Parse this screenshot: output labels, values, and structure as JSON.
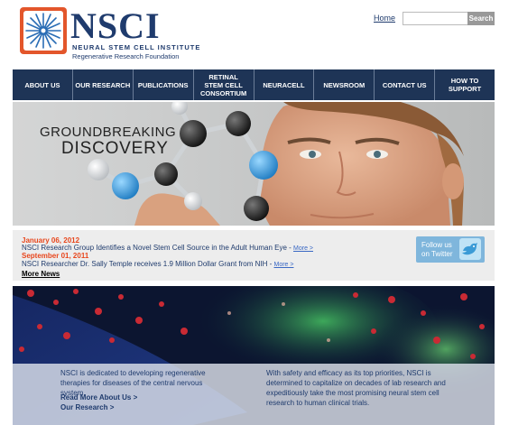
{
  "brand": {
    "name": "NSCI",
    "tagline": "NEURAL STEM CELL INSTITUTE",
    "subtitle": "Regenerative Research Foundation"
  },
  "header": {
    "home_label": "Home",
    "search_placeholder": "",
    "search_button": "Search"
  },
  "nav": [
    {
      "label": "ABOUT US"
    },
    {
      "label": "OUR RESEARCH"
    },
    {
      "label": "PUBLICATIONS"
    },
    {
      "label": "RETINAL\nSTEM CELL\nCONSORTIUM"
    },
    {
      "label": "NEURACELL"
    },
    {
      "label": "NEWSROOM"
    },
    {
      "label": "CONTACT US"
    },
    {
      "label": "HOW TO\nSUPPORT"
    }
  ],
  "hero": {
    "line1": "GROUNDBREAKING",
    "line2": "DISCOVERY"
  },
  "news": {
    "items": [
      {
        "date": "January 06, 2012",
        "text": "NSCI Research Group Identifies a Novel Stem Cell Source in the Adult Human Eye - ",
        "more": "More >"
      },
      {
        "date": "September 01, 2011",
        "text": "NSCI Researcher Dr. Sally Temple receives 1.9 Million Dollar Grant from NIH - ",
        "more": "More >"
      }
    ],
    "more_news": "More News"
  },
  "twitter": {
    "line1": "Follow us",
    "line2": "on Twitter"
  },
  "info": {
    "left_text": "NSCI is dedicated to developing regenerative therapies for diseases of the central nervous system.",
    "right_text": "With safety and efficacy as its top priorities, NSCI is determined to capitalize on decades of lab research and expeditiously take the most promising neural stem cell research to human clinical trials.",
    "link1": "Read More About Us >",
    "link2": "Our Research >"
  },
  "colors": {
    "nav_bg": "#1e3456",
    "brand_navy": "#1f3b6d",
    "news_date": "#e8471d",
    "logo_orange": "#e3562b",
    "twitter_blue": "#7fb6dc"
  }
}
